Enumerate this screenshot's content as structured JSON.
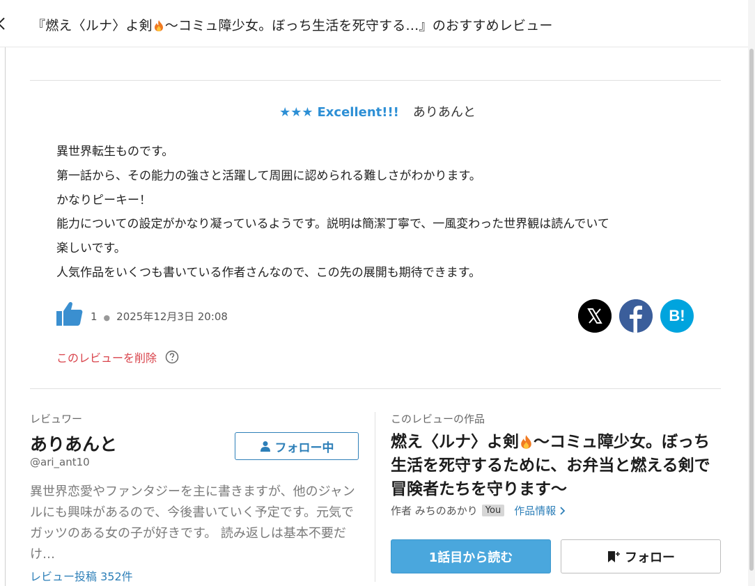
{
  "header": {
    "title_before": "『燃え〈ルナ〉よ剣",
    "title_after": "～コミュ障少女。ぼっち生活を死守する…』のおすすめレビュー"
  },
  "review": {
    "stars": "★★★",
    "rating_label": "Excellent!!!",
    "reviewer_name": "ありあんと",
    "body_lines": [
      "異世界転生ものです。",
      "第一話から、その能力の強さと活躍して周囲に認められる難しさがわかります。",
      "かなりピーキー！",
      "能力についての設定がかなり凝っているようです。説明は簡潔丁寧で、一風変わった世界観は読んでいて",
      "楽しいです。",
      "人気作品をいくつも書いている作者さんなので、この先の展開も期待できます。"
    ],
    "like_count": "1",
    "date": "2025年12月3日 20:08",
    "delete_label": "このレビューを削除",
    "share": {
      "x_label": "X",
      "hatena_label": "B!"
    }
  },
  "reviewer": {
    "section_label": "レビュワー",
    "name": "ありあんと",
    "handle": "@ari_ant10",
    "follow_label": "フォロー中",
    "bio": "異世界恋愛やファンタジーを主に書きますが、他のジャンルにも興味があるので、今後書いていく予定です。元気でガッツのある女の子が好きです。 読み返しは基本不要だけ…",
    "review_count_label": "レビュー投稿 352件"
  },
  "work": {
    "section_label": "このレビューの作品",
    "title_before": "燃え〈ルナ〉よ剣",
    "title_after": "～コミュ障少女。ぼっち生活を死守するために、お弁当と燃える剣で冒険者たちを守ります～",
    "author_label": "作者 みちのあかり",
    "you_badge": "You",
    "info_label": "作品情報",
    "read_label": "1話目から読む",
    "follow_label": "フォロー"
  },
  "colors": {
    "accent": "#2d8fd5",
    "link": "#2d7fb8",
    "danger": "#d9434b",
    "read_button": "#4aa7dd",
    "facebook": "#3b5e9b",
    "hatena": "#00a4de"
  }
}
